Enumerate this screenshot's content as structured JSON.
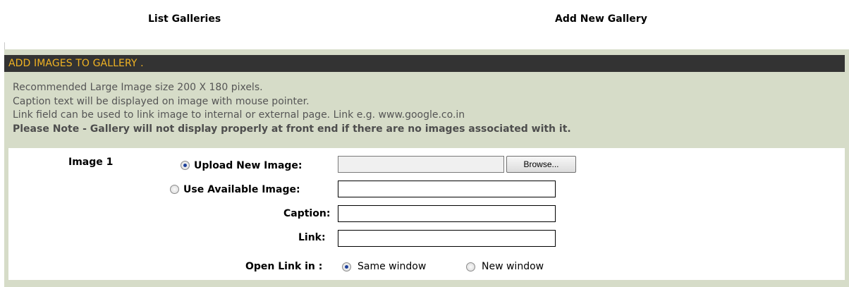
{
  "tabs": {
    "list_galleries": "List Galleries",
    "add_new_gallery": "Add New Gallery"
  },
  "panel": {
    "header": "ADD IMAGES TO GALLERY .",
    "info": [
      "Recommended Large Image size 200 X 180 pixels.",
      "Caption text will be displayed on image with mouse pointer.",
      "Link field can be used to link image to internal or external page. Link e.g. www.google.co.in"
    ],
    "note": "Please Note - Gallery will not display properly at front end if there are no images associated with it."
  },
  "form": {
    "image_label": "Image 1",
    "upload_label": "Upload New Image:",
    "upload_selected": true,
    "browse_label": "Browse...",
    "available_label": "Use Available Image:",
    "available_value": "",
    "caption_label": "Caption:",
    "caption_value": "",
    "link_label": "Link:",
    "link_value": "",
    "open_link_label": "Open Link in :",
    "open_link_options": [
      "Same window",
      "New window"
    ],
    "open_link_selected": "Same window"
  },
  "colors": {
    "header_bg": "#333333",
    "header_text": "#f0b323",
    "panel_bg": "#d6dcc8",
    "radio_dot": "#1c3f9a"
  }
}
